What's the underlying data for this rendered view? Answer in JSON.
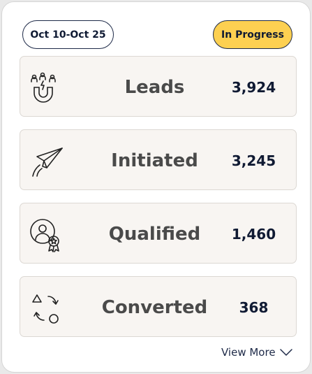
{
  "header": {
    "date_range": "Oct 10-Oct 25",
    "status": "In Progress",
    "status_color": "#fdd051"
  },
  "funnel": [
    {
      "label": "Leads",
      "value": "3,924",
      "icon": "magnet-people-icon"
    },
    {
      "label": "Initiated",
      "value": "3,245",
      "icon": "paper-plane-icon"
    },
    {
      "label": "Qualified",
      "value": "1,460",
      "icon": "person-badge-icon"
    },
    {
      "label": "Converted",
      "value": "368",
      "icon": "conversion-cycle-icon"
    }
  ],
  "footer": {
    "view_more": "View More",
    "icon": "chevron-down-icon"
  }
}
